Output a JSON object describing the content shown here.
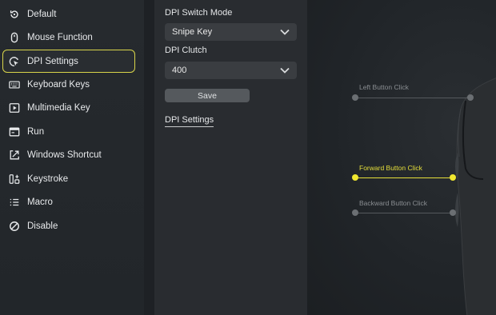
{
  "sidebar": {
    "items": [
      {
        "label": "Default",
        "icon": "reset-icon"
      },
      {
        "label": "Mouse Function",
        "icon": "mouse-icon"
      },
      {
        "label": "DPI Settings",
        "icon": "dpi-icon",
        "active": true
      },
      {
        "label": "Keyboard Keys",
        "icon": "keyboard-icon"
      },
      {
        "label": "Multimedia Key",
        "icon": "play-icon"
      },
      {
        "label": "Run",
        "icon": "window-icon"
      },
      {
        "label": "Windows Shortcut",
        "icon": "shortcut-icon"
      },
      {
        "label": "Keystroke",
        "icon": "keystroke-icon"
      },
      {
        "label": "Macro",
        "icon": "list-icon"
      },
      {
        "label": "Disable",
        "icon": "disable-icon"
      }
    ]
  },
  "panel": {
    "switch_mode_label": "DPI Switch Mode",
    "switch_mode_value": "Snipe Key",
    "clutch_label": "DPI Clutch",
    "clutch_value": "400",
    "save_label": "Save",
    "tab_label": "DPI Settings"
  },
  "preview": {
    "left_click": "Left Button Click",
    "forward_click": "Forward Button Click",
    "backward_click": "Backward Button Click"
  },
  "colors": {
    "accent": "#e6df3a"
  }
}
